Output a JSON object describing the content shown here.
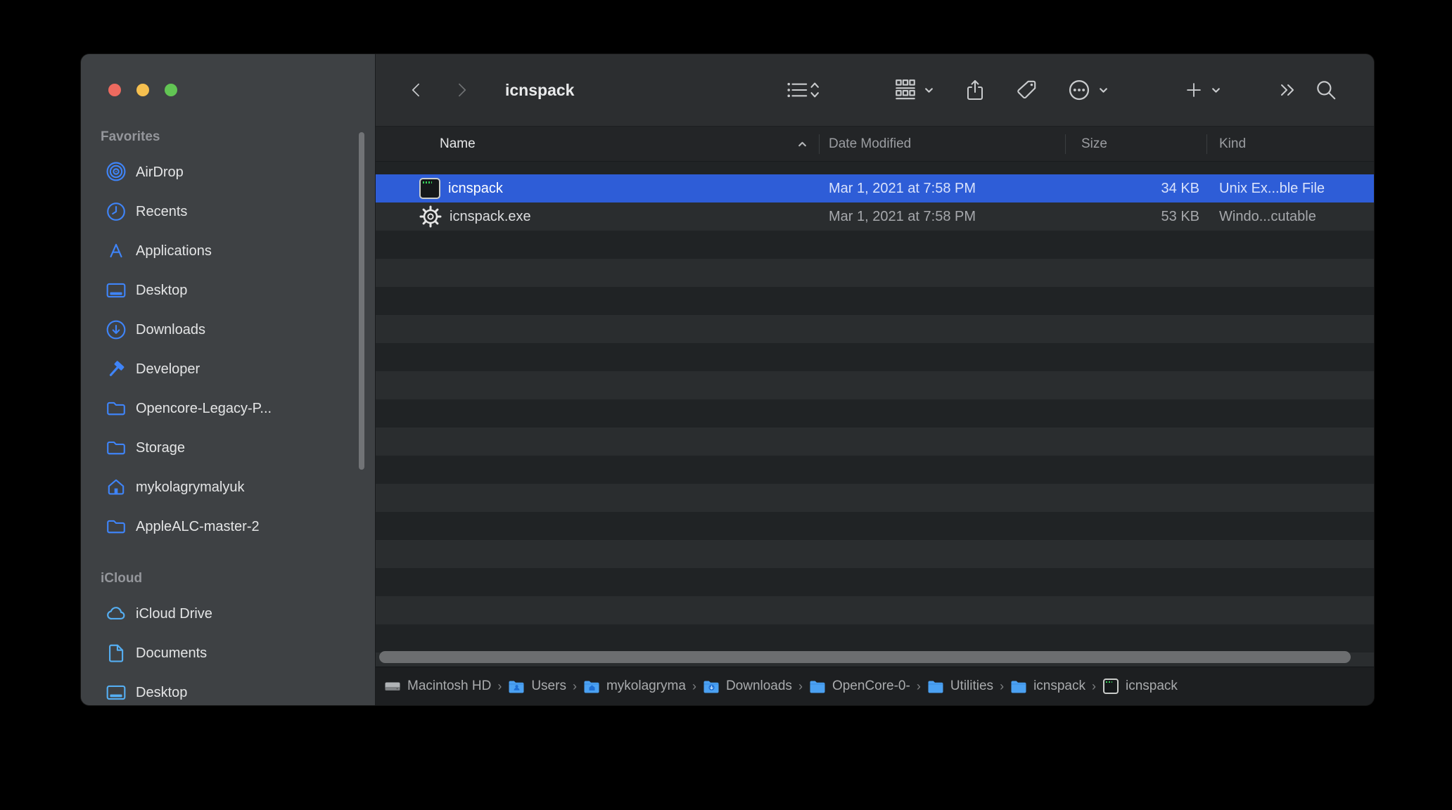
{
  "window": {
    "title": "icnspack"
  },
  "traffic_lights": {
    "close": "#ed6a5f",
    "minimize": "#f5bf4f",
    "zoom": "#62c554"
  },
  "toolbar": {
    "buttons": [
      {
        "name": "view-switcher",
        "icon": "list-view-icon"
      },
      {
        "name": "group-by",
        "icon": "group-icon",
        "chevron": true
      },
      {
        "name": "share",
        "icon": "share-icon"
      },
      {
        "name": "tags",
        "icon": "tag-icon"
      },
      {
        "name": "more-actions",
        "icon": "ellipsis-circle-icon",
        "chevron": true
      },
      {
        "name": "add",
        "icon": "plus-icon",
        "chevron": true
      },
      {
        "name": "overflow",
        "icon": "double-chevron-right-icon"
      },
      {
        "name": "search",
        "icon": "search-icon"
      }
    ]
  },
  "sidebar": {
    "sections": [
      {
        "title": "Favorites",
        "items": [
          {
            "label": "AirDrop",
            "icon": "airdrop-icon"
          },
          {
            "label": "Recents",
            "icon": "clock-icon"
          },
          {
            "label": "Applications",
            "icon": "appstore-icon"
          },
          {
            "label": "Desktop",
            "icon": "desktop-icon"
          },
          {
            "label": "Downloads",
            "icon": "downloads-icon"
          },
          {
            "label": "Developer",
            "icon": "hammer-icon"
          },
          {
            "label": "Opencore-Legacy-P...",
            "icon": "folder-icon"
          },
          {
            "label": "Storage",
            "icon": "folder-icon"
          },
          {
            "label": "mykolagrymalyuk",
            "icon": "home-icon"
          },
          {
            "label": "AppleALC-master-2",
            "icon": "folder-icon"
          }
        ]
      },
      {
        "title": "iCloud",
        "items": [
          {
            "label": "iCloud Drive",
            "icon": "cloud-icon"
          },
          {
            "label": "Documents",
            "icon": "document-icon"
          },
          {
            "label": "Desktop",
            "icon": "desktop-icon"
          }
        ]
      }
    ]
  },
  "list": {
    "columns": [
      {
        "label": "Name",
        "sorted": true
      },
      {
        "label": "Date Modified"
      },
      {
        "label": "Size"
      },
      {
        "label": "Kind"
      }
    ],
    "rows": [
      {
        "name": "icnspack",
        "icon": "unix-executable-icon",
        "date_modified": "Mar 1, 2021 at 7:58 PM",
        "size": "34 KB",
        "kind": "Unix Ex...ble File",
        "selected": true
      },
      {
        "name": "icnspack.exe",
        "icon": "windows-executable-icon",
        "date_modified": "Mar 1, 2021 at 7:58 PM",
        "size": "53 KB",
        "kind": "Windo...cutable",
        "selected": false
      }
    ]
  },
  "pathbar": {
    "separator": "›",
    "items": [
      {
        "label": "Macintosh HD",
        "icon": "harddrive-icon"
      },
      {
        "label": "Users",
        "icon": "folder-users-icon"
      },
      {
        "label": "mykolagryma",
        "icon": "folder-home-icon"
      },
      {
        "label": "Downloads",
        "icon": "folder-downloads-icon"
      },
      {
        "label": "OpenCore-0-",
        "icon": "folder-icon"
      },
      {
        "label": "Utilities",
        "icon": "folder-icon"
      },
      {
        "label": "icnspack",
        "icon": "folder-icon"
      },
      {
        "label": "icnspack",
        "icon": "unix-executable-icon"
      }
    ]
  },
  "colors": {
    "selection_blue": "#2e5dd7",
    "sidebar_icon_blue": "#3f84f8",
    "icloud_icon_blue": "#55aef2",
    "sidebar_bg": "#3e4144",
    "toolbar_bg": "#2c2e30",
    "row_stripe_dark": "#202325",
    "row_stripe_light": "#2a2d2f",
    "pathbar_bg": "#1d1f21"
  }
}
